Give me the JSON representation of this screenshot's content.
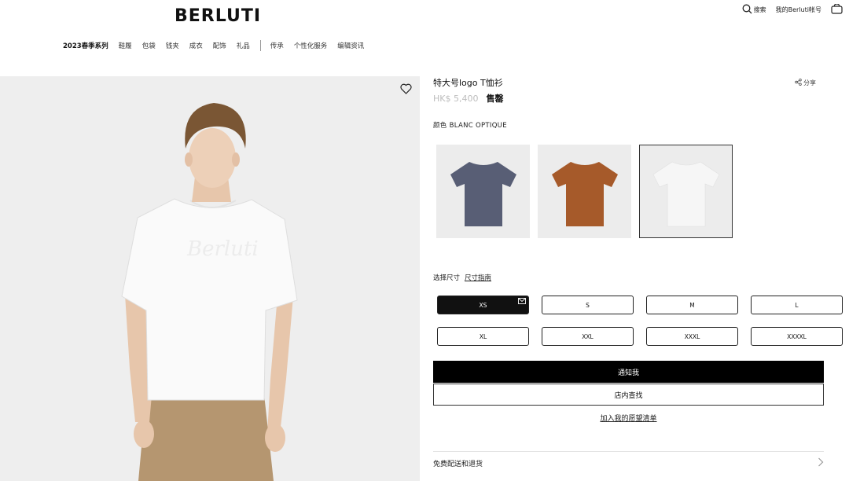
{
  "brand": {
    "logo": "BERLUTI"
  },
  "topbar": {
    "search_label": "搜索",
    "account_label": "我的Berluti帐号"
  },
  "nav": {
    "items": [
      "2023春季系列",
      "鞋履",
      "包袋",
      "钱夹",
      "成衣",
      "配饰",
      "礼品"
    ],
    "secondary": [
      "传承",
      "个性化服务",
      "编辑资讯"
    ]
  },
  "product": {
    "name": "特大号logo T恤衫",
    "price": "HK$ 5,400",
    "status": "售罄",
    "share_label": "分享",
    "color_label": "颜色 BLANC OPTIQUE",
    "swatches": [
      {
        "color": "#585e75",
        "name": "navy"
      },
      {
        "color": "#a65a2a",
        "name": "brown"
      },
      {
        "color": "#f6f6f6",
        "name": "white",
        "selected": true
      }
    ]
  },
  "size_section": {
    "label": "选择尺寸",
    "guide": "尺寸指南",
    "sizes": [
      "XS",
      "S",
      "M",
      "L",
      "XL",
      "XXL",
      "XXXL",
      "XXXXL"
    ],
    "selected": "XS"
  },
  "actions": {
    "notify": "通知我",
    "find_in_store": "店内查找",
    "add_wishlist": "加入我的愿望清单"
  },
  "shipping": {
    "label": "免费配送和退货"
  },
  "colors": {
    "image_bg": "#eeeeee",
    "swatch_bg": "#ececec",
    "price_grey": "#bdbdbd",
    "primary_black": "#000000"
  },
  "icons": [
    "search-icon",
    "bag-icon",
    "heart-icon",
    "share-icon",
    "mail-icon",
    "chevron-right-icon"
  ]
}
